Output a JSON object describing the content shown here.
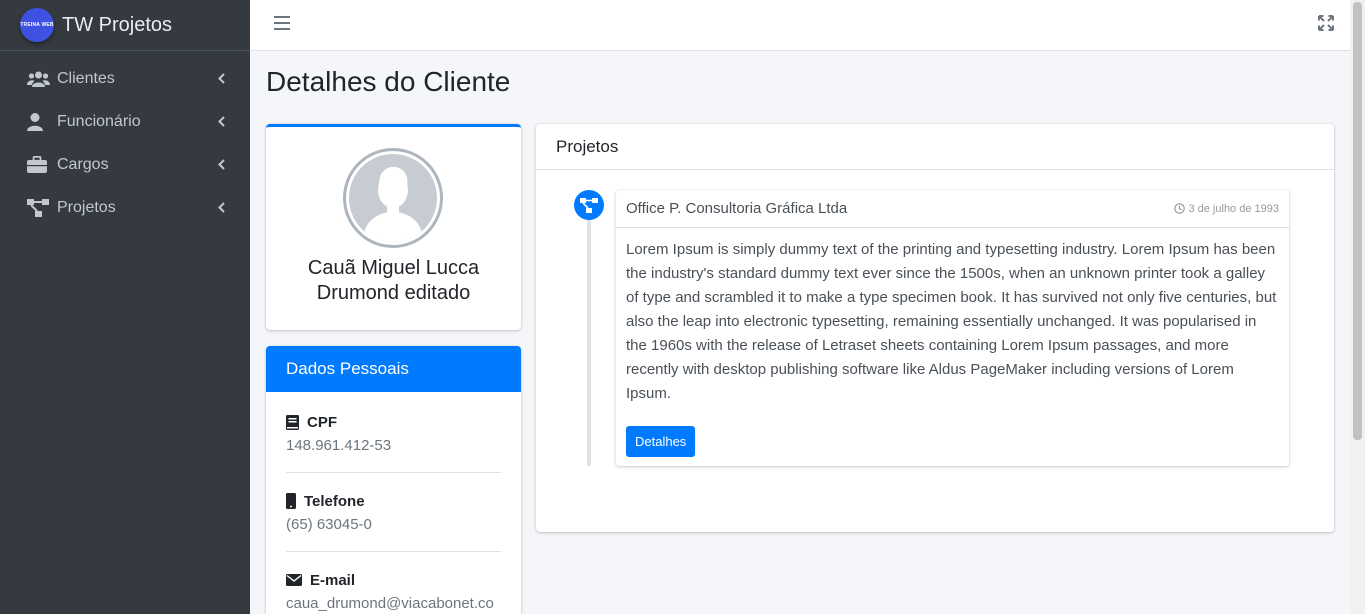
{
  "brand": {
    "name": "TW Projetos",
    "logo_text": "TREINA WEB"
  },
  "sidebar": {
    "items": [
      {
        "label": "Clientes",
        "icon": "users-icon"
      },
      {
        "label": "Funcionário",
        "icon": "user-icon"
      },
      {
        "label": "Cargos",
        "icon": "briefcase-icon"
      },
      {
        "label": "Projetos",
        "icon": "project-diagram-icon"
      }
    ]
  },
  "page": {
    "title": "Detalhes do Cliente"
  },
  "profile": {
    "name": "Cauã Miguel Lucca Drumond editado"
  },
  "dados": {
    "header": "Dados Pessoais",
    "cpf_label": "CPF",
    "cpf_value": "148.961.412-53",
    "telefone_label": "Telefone",
    "telefone_value": "(65) 63045-0",
    "email_label": "E-mail",
    "email_value": "caua_drumond@viacabonet.co"
  },
  "projetos": {
    "header": "Projetos",
    "items": [
      {
        "title": "Office P. Consultoria Gráfica Ltda",
        "date": "3 de julho de 1993",
        "description": "Lorem Ipsum is simply dummy text of the printing and typesetting industry. Lorem Ipsum has been the industry's standard dummy text ever since the 1500s, when an unknown printer took a galley of type and scrambled it to make a type specimen book. It has survived not only five centuries, but also the leap into electronic typesetting, remaining essentially unchanged. It was popularised in the 1960s with the release of Letraset sheets containing Lorem Ipsum passages, and more recently with desktop publishing software like Aldus PageMaker including versions of Lorem Ipsum.",
        "button_label": "Detalhes"
      }
    ]
  },
  "colors": {
    "primary": "#007bff",
    "sidebar_bg": "#343a40",
    "content_bg": "#f4f6f9"
  }
}
